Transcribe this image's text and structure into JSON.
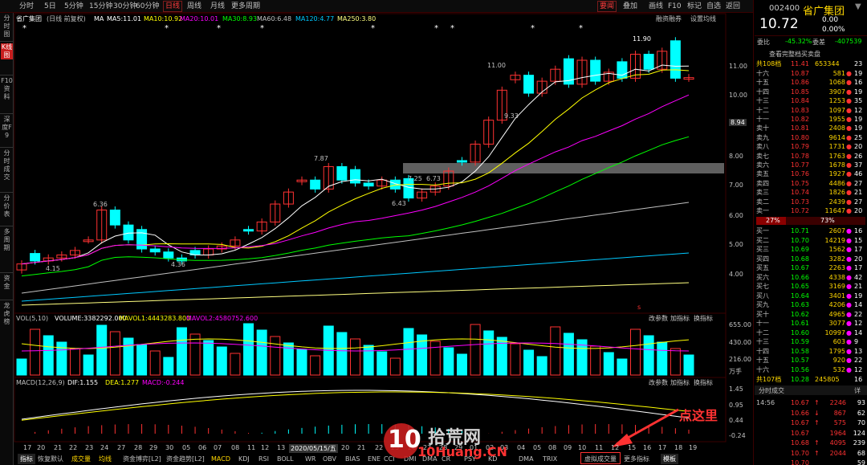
{
  "toolbar": {
    "items": [
      "分时",
      "5日",
      "5分钟",
      "15分钟",
      "30分钟",
      "60分钟",
      "日线",
      "周线",
      "月线",
      "更多周期"
    ],
    "selected": "日线",
    "right_buttons": [
      "要闻",
      "叠加",
      "画线",
      "F10",
      "标记",
      "自选",
      "返回"
    ]
  },
  "sidebar": [
    "分时图",
    "K线图",
    "F10资料",
    "深度F9",
    "分时成交",
    "分价表",
    "多周期",
    "资金",
    "龙虎榜"
  ],
  "sidebar_selected": "K线图",
  "header": {
    "name": "省广集团",
    "period": "(日线 前复权)",
    "ma": "MA",
    "ma5": "MA5:11.01",
    "ma10": "MA10:10.92",
    "ma20": "MA20:10.01",
    "ma30": "MA30:8.93",
    "ma60": "MA60:6.48",
    "ma120": "MA120:4.77",
    "ma250": "MA250:3.80",
    "rzrq": "融资融券",
    "settings": "设置均线"
  },
  "main_chart": {
    "price_labels": [
      "11.90",
      "11.00",
      "9.33",
      "7.87",
      "7.25",
      "6.73",
      "6.43",
      "6.36",
      "4.36",
      "4.15"
    ],
    "axis_labels": [
      "11.00",
      "10.00",
      "8.94",
      "8.00",
      "7.00",
      "6.00",
      "5.00",
      "4.00"
    ],
    "current_label": "8.94",
    "marker_s": "s"
  },
  "volume_panel": {
    "title": "VOL(5,10)",
    "volume": "VOLUME:3382292.000",
    "mavol1": "MAVOL1:4443283.800",
    "mavol2": "MAVOL2:4580752.600",
    "change_param": "改参数",
    "add_ind": "加指标",
    "swap_ind": "换指标",
    "axis_labels": [
      "655.00",
      "430.00",
      "216.00",
      "万手"
    ]
  },
  "macd_panel": {
    "title": "MACD(12,26,9)",
    "dif": "DIF:1.155",
    "dea": "DEA:1.277",
    "macd": "MACD:-0.244",
    "change_param": "改参数",
    "add_ind": "加指标",
    "swap_ind": "换指标",
    "axis_labels": [
      "1.45",
      "0.95",
      "0.44",
      "-0.24"
    ]
  },
  "x_axis": [
    "17",
    "20",
    "21",
    "22",
    "23",
    "24",
    "27",
    "28",
    "29",
    "30",
    "05",
    "06",
    "07",
    "08",
    "11",
    "12",
    "13",
    "14",
    "2020/05/15/五",
    "20",
    "21",
    "22",
    "25",
    "26",
    "27",
    "28",
    "29",
    "01",
    "02",
    "03",
    "04",
    "05",
    "08",
    "09",
    "10",
    "11",
    "12",
    "15",
    "16",
    "17",
    "18",
    "19"
  ],
  "bottom_tabs": [
    "指标",
    "恢复默认",
    "成交量",
    "均线",
    "资金博弈[L2]",
    "资金趋势[L2]",
    "MACD",
    "KDJ",
    "RSI",
    "BOLL",
    "WR",
    "OBV",
    "BIAS",
    "ENE",
    "CCI",
    "DMI",
    "DMA",
    "CR",
    "PSY",
    "KD",
    "DMA",
    "TRIX",
    "虚拟成交量",
    "更多指标",
    "模板"
  ],
  "annotation": "点这里",
  "watermark": {
    "text": "拾荒网",
    "url": "10Huang.CN"
  },
  "quote": {
    "code": "002400",
    "name": "省广集团",
    "price": "10.72",
    "change": "0.00",
    "change_pct": "0.00%",
    "weibi_label": "委比",
    "weibi": "-45.32%",
    "weicha_label": "委差",
    "weicha": "-407539",
    "view_full": "查看完整档买卖盘",
    "total_label": "共108档",
    "total_price": "11.41",
    "total_vol": "653344",
    "total_cnt": "23",
    "ratio_left": "27%",
    "ratio_right": "73%",
    "total2_label": "共107档",
    "total2_price": "10.28",
    "total2_vol": "245805",
    "total2_cnt": "16"
  },
  "sells": [
    [
      "十六",
      "10.87",
      "581",
      "19"
    ],
    [
      "十五",
      "10.86",
      "1068",
      "16"
    ],
    [
      "十四",
      "10.85",
      "3907",
      "19"
    ],
    [
      "十三",
      "10.84",
      "1253",
      "35"
    ],
    [
      "十二",
      "10.83",
      "1097",
      "12"
    ],
    [
      "十一",
      "10.82",
      "1955",
      "19"
    ],
    [
      "卖十",
      "10.81",
      "2408",
      "19"
    ],
    [
      "卖九",
      "10.80",
      "9614",
      "25"
    ],
    [
      "卖八",
      "10.79",
      "1731",
      "20"
    ],
    [
      "卖七",
      "10.78",
      "1763",
      "26"
    ],
    [
      "卖六",
      "10.77",
      "1678",
      "37"
    ],
    [
      "卖五",
      "10.76",
      "1927",
      "46"
    ],
    [
      "卖四",
      "10.75",
      "4486",
      "27"
    ],
    [
      "卖三",
      "10.74",
      "1826",
      "21"
    ],
    [
      "卖二",
      "10.73",
      "2439",
      "27"
    ],
    [
      "卖一",
      "10.72",
      "11647",
      "20"
    ]
  ],
  "buys": [
    [
      "买一",
      "10.71",
      "2607",
      "16"
    ],
    [
      "买二",
      "10.70",
      "14219",
      "15"
    ],
    [
      "买三",
      "10.69",
      "1562",
      "17"
    ],
    [
      "买四",
      "10.68",
      "3282",
      "20"
    ],
    [
      "买五",
      "10.67",
      "2263",
      "17"
    ],
    [
      "买六",
      "10.66",
      "4338",
      "42"
    ],
    [
      "买七",
      "10.65",
      "3169",
      "21"
    ],
    [
      "买八",
      "10.64",
      "3401",
      "19"
    ],
    [
      "买九",
      "10.63",
      "4206",
      "14"
    ],
    [
      "买十",
      "10.62",
      "4965",
      "22"
    ],
    [
      "十一",
      "10.61",
      "3077",
      "12"
    ],
    [
      "十二",
      "10.60",
      "10997",
      "14"
    ],
    [
      "十三",
      "10.59",
      "603",
      "9"
    ],
    [
      "十四",
      "10.58",
      "1795",
      "13"
    ],
    [
      "十五",
      "10.57",
      "920",
      "22"
    ],
    [
      "十六",
      "10.56",
      "532",
      "12"
    ]
  ],
  "trades_title": "分时成交",
  "trades_detail": "详",
  "trades": [
    [
      "14:56",
      "10.67",
      "↑",
      "2246",
      "93"
    ],
    [
      "",
      "10.66",
      "↓",
      "867",
      "62"
    ],
    [
      "",
      "10.67",
      "↑",
      "575",
      "70"
    ],
    [
      "",
      "10.67",
      "",
      "1964",
      "124"
    ],
    [
      "",
      "10.68",
      "↑",
      "4095",
      "239"
    ],
    [
      "",
      "10.70",
      "↑",
      "2044",
      "68"
    ],
    [
      "",
      "10.70",
      "",
      "",
      "59"
    ]
  ],
  "colors": {
    "up": "#ff3232",
    "down": "#00ffff",
    "ma5": "#ffffff",
    "ma10": "#ffff00",
    "ma20": "#ff00ff",
    "ma30": "#00ff00",
    "ma60": "#c0c0c0",
    "ma120": "#00c8ff",
    "ma250": "#ffff80",
    "price": "#ff3232"
  },
  "icons": [
    "arrow-down-icon",
    "star-icon",
    "arrow-right-icon"
  ]
}
